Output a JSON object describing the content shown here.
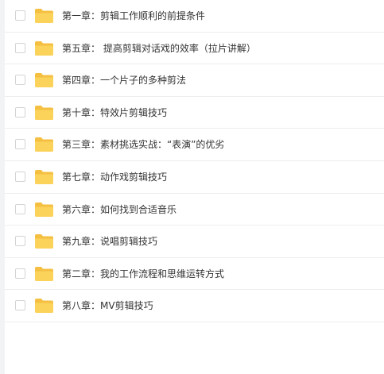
{
  "colors": {
    "folder_back": "#f5c042",
    "folder_front": "#fbd25a",
    "text": "#333333",
    "divider": "#eeeeee"
  },
  "items": [
    {
      "name": "第一章：剪辑工作顺利的前提条件",
      "icon": "folder-icon",
      "checked": false
    },
    {
      "name": "第五章： 提高剪辑对话戏的效率（拉片讲解）",
      "icon": "folder-icon",
      "checked": false
    },
    {
      "name": "第四章：一个片子的多种剪法",
      "icon": "folder-icon",
      "checked": false
    },
    {
      "name": "第十章：特效片剪辑技巧",
      "icon": "folder-icon",
      "checked": false
    },
    {
      "name": "第三章：素材挑选实战：“表演”的优劣",
      "icon": "folder-icon",
      "checked": false
    },
    {
      "name": "第七章：动作戏剪辑技巧",
      "icon": "folder-icon",
      "checked": false
    },
    {
      "name": "第六章：如何找到合适音乐",
      "icon": "folder-icon",
      "checked": false
    },
    {
      "name": "第九章：说唱剪辑技巧",
      "icon": "folder-icon",
      "checked": false
    },
    {
      "name": "第二章：我的工作流程和思维运转方式",
      "icon": "folder-icon",
      "checked": false
    },
    {
      "name": "第八章：MV剪辑技巧",
      "icon": "folder-icon",
      "checked": false
    }
  ]
}
